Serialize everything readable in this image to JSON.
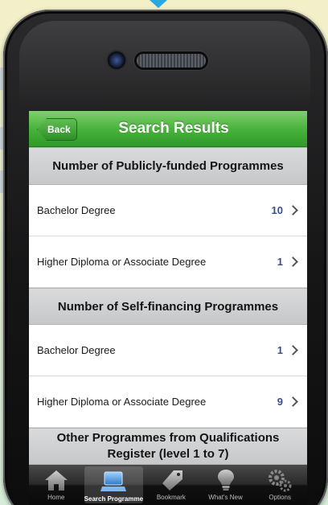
{
  "nav": {
    "back_label": "Back",
    "title": "Search Results"
  },
  "sections": [
    {
      "header": "Number of Publicly-funded Programmes",
      "rows": [
        {
          "label": "Bachelor Degree",
          "count": "10"
        },
        {
          "label": "Higher Diploma or Associate Degree",
          "count": "1"
        }
      ]
    },
    {
      "header": "Number of Self-financing Programmes",
      "rows": [
        {
          "label": "Bachelor Degree",
          "count": "1"
        },
        {
          "label": "Higher Diploma or Associate Degree",
          "count": "9"
        }
      ]
    },
    {
      "header_line1": "Other Programmes from Qualifications",
      "header_line2": "Register (level 1 to 7)"
    }
  ],
  "tabs": [
    {
      "label": "Home",
      "icon": "home-icon"
    },
    {
      "label": "Search Programme",
      "icon": "monitor-icon",
      "active": true
    },
    {
      "label": "Bookmark",
      "icon": "tag-icon"
    },
    {
      "label": "What's New",
      "icon": "lightbulb-icon"
    },
    {
      "label": "Options",
      "icon": "gears-icon"
    }
  ],
  "colors": {
    "nav_green": "#4ab33d",
    "count_blue": "#3a4f86",
    "accent_marker": "#29a8e0"
  }
}
